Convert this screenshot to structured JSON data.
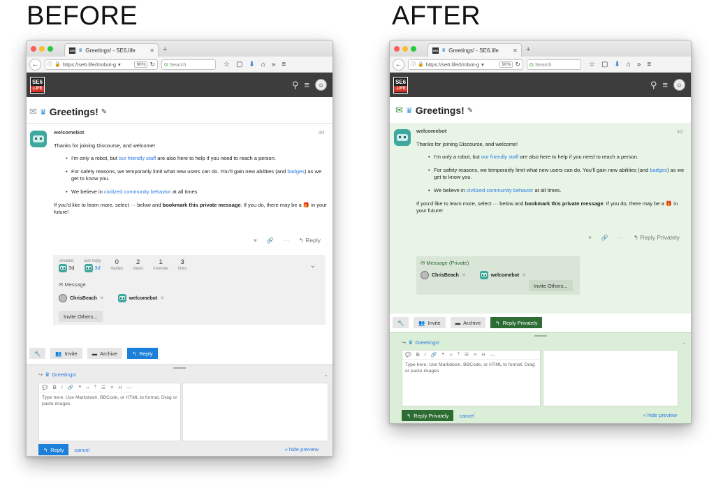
{
  "labels": {
    "before": "BEFORE",
    "after": "AFTER"
  },
  "browser": {
    "tab_title_before": "Greetings! - SE6.life",
    "tab_title_after": "Greetings! - SE6.life",
    "url": "https://se6.life/t/robot-g",
    "zoom": "90%",
    "search_placeholder": "Search"
  },
  "site": {
    "logo_top": "SE6",
    "logo_bottom": ".LIFE"
  },
  "topic": {
    "title": "Greetings!"
  },
  "post": {
    "username": "welcomebot",
    "age": "3d",
    "intro": "Thanks for joining Discourse, and welcome!",
    "b1_pre": "I’m only a robot, but ",
    "b1_link": "our friendly staff",
    "b1_post": " are also here to help if you need to reach a person.",
    "b2_pre": "For safety reasons, we temporarily limit what new users can do. You’ll gain new abilities (and ",
    "b2_link": "badges",
    "b2_post": ") as we get to know you.",
    "b3_pre": "We believe in ",
    "b3_link": "civilized community behavior",
    "b3_post": " at all times.",
    "outro_pre": "If you’d like to learn more, select ··· below and ",
    "outro_bold": "bookmark this private message",
    "outro_post": ". If you do, there may be a",
    "outro_end": " in your future!",
    "reply_before": "Reply",
    "reply_after": "Reply Privately"
  },
  "topic_map": {
    "created_label": "created",
    "created_value": "3d",
    "last_reply_label": "last reply",
    "last_reply_value": "3d",
    "stats": [
      {
        "value": "0",
        "label": "replies"
      },
      {
        "value": "2",
        "label": "views"
      },
      {
        "value": "1",
        "label": "member"
      },
      {
        "value": "3",
        "label": "links"
      }
    ],
    "message_label_before": "Message",
    "message_label_after": "Message (Private)",
    "participant_1": "ChrisBeach",
    "participant_2": "welcomebot",
    "invite_others": "Invite Others..."
  },
  "footer_buttons": {
    "invite": "Invite",
    "archive": "Archive",
    "reply_before": "Reply",
    "reply_after": "Reply Privately"
  },
  "composer": {
    "title": "Greetings!",
    "placeholder": "Type here. Use Markdown, BBCode, or HTML to format. Drag or paste images.",
    "reply_before": "Reply",
    "reply_after": "Reply Privately",
    "cancel": "cancel",
    "hide_preview": "« hide preview"
  },
  "colors": {
    "blue": "#1c7fd9",
    "green": "#2d6c32",
    "private_bg": "#e8f5e6",
    "header_bg": "#3d3d3d"
  }
}
